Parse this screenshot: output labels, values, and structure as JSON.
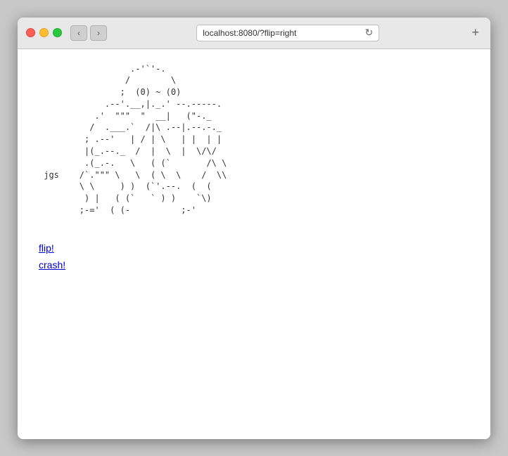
{
  "browser": {
    "title": "localhost:8080/?flip=right",
    "url": "localhost:8080/?flip=right",
    "back_label": "‹",
    "forward_label": "›",
    "reload_label": "↻",
    "new_tab_label": "+"
  },
  "page": {
    "ascii_art": "                  .-'\"\"\"'-.\n                 /          ;\n                ;   (0) ~ (0\n              .--.____,  |._.--.----.\n            .'   \"\"\" \" \".__|   (\"_.-\n           /    .____.' /|\\   |.--.-._\n          ;  .--'    | / | \\  |  |  | |\n          | (_.--._  |/  |  \\ |  \\/\\/\n          .(_.-.   \\    (  (`       /\\ \\\n jgs     /`.\"\"\" \\  \\   ( \\  \\      /  \\\\\n         \\ \\     ) )    `'.--.   (  (\n          ) |   ( (`     `  ) )    `\\)\n         ;-='   ( (-           ;-'",
    "ascii_art_full": "                 .-'\"\"\"`'.\n                /    ;    \\\n               ;  (0) ~ (0 )\n            .-'  __,|._,'  '-.\n          .' \"\"\"  \"  |        '.\n         /  .___.`  /|\\        \\\n        ;  /     | / | \\  ;----.-._\n        | |    . |/  |  \\ |   | | |\n        | \\_.-`  /   |   \\|   \\/\\/\n        '.(  _.-'   ( `       /\\ \\\n jgs   /`.\"\"\" \\     ( \\      /  \\\\\n       \\ \\     ) )   `''-.  (  (\n        ) |   ( (    `  ) )  `\\)\n       ;-='  ( (-          ;-'",
    "links": [
      {
        "label": "flip!",
        "href": "/?flip=left"
      },
      {
        "label": "crash!",
        "href": "/crash"
      }
    ]
  }
}
